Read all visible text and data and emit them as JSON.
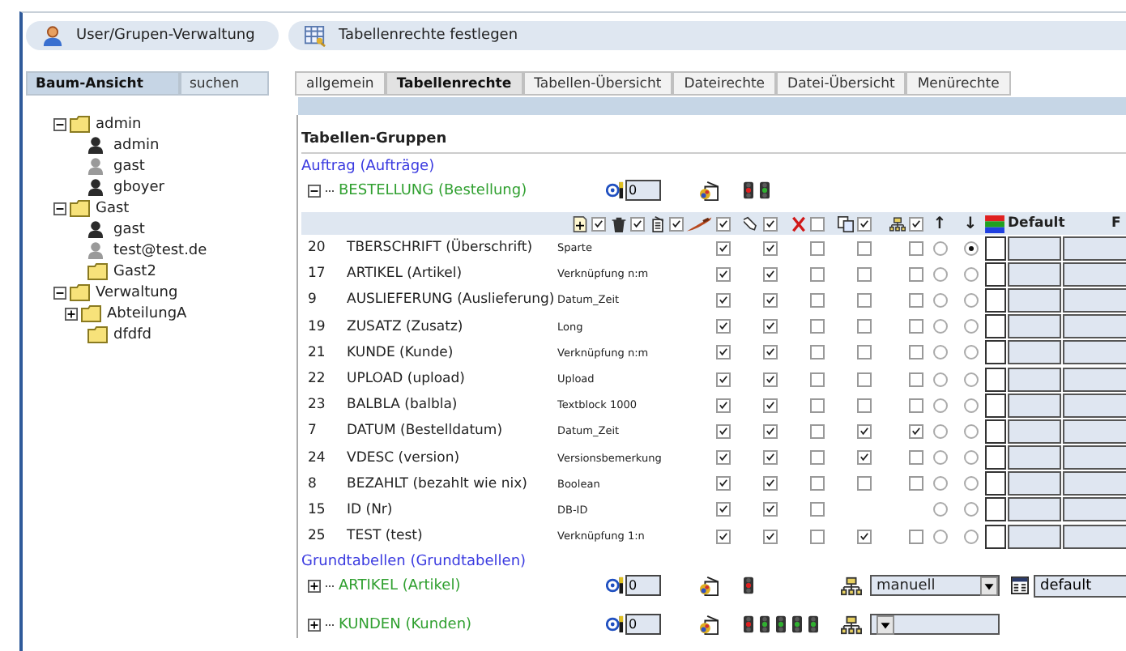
{
  "header_buttons": [
    {
      "kind": "user",
      "label": "User/Grupen-Verwaltung"
    },
    {
      "kind": "table",
      "label": "Tabellenrechte festlegen"
    }
  ],
  "sidebar": {
    "tabs": [
      {
        "label": "Baum-Ansicht",
        "selected": true
      },
      {
        "label": "suchen",
        "selected": false
      }
    ],
    "tree": [
      {
        "kind": "folder",
        "label": "admin",
        "expanded": true,
        "children": [
          {
            "kind": "user",
            "label": "admin",
            "active": true
          },
          {
            "kind": "user",
            "label": "gast",
            "active": false
          },
          {
            "kind": "user",
            "label": "gboyer",
            "active": true
          }
        ]
      },
      {
        "kind": "folder",
        "label": "Gast",
        "expanded": true,
        "children": [
          {
            "kind": "user",
            "label": "gast",
            "active": true
          },
          {
            "kind": "user",
            "label": "test@test.de",
            "active": false
          },
          {
            "kind": "folder",
            "label": "Gast2"
          }
        ]
      },
      {
        "kind": "folder",
        "label": "Verwaltung",
        "expanded": true,
        "children": [
          {
            "kind": "folder",
            "label": "AbteilungA",
            "expanded": false
          },
          {
            "kind": "folder",
            "label": "dfdfd"
          }
        ]
      }
    ]
  },
  "tabs": [
    {
      "label": "allgemein",
      "selected": false
    },
    {
      "label": "Tabellenrechte",
      "selected": true
    },
    {
      "label": "Tabellen-Übersicht",
      "selected": false
    },
    {
      "label": "Dateirechte",
      "selected": false
    },
    {
      "label": "Datei-Übersicht",
      "selected": false
    },
    {
      "label": "Menürechte",
      "selected": false
    }
  ],
  "section_title": "Tabellen-Gruppen",
  "groups": [
    {
      "label": "Auftrag (Aufträge)",
      "tables": [
        {
          "label": "BESTELLUNG (Bestellung)",
          "expanded": true,
          "count": "0",
          "lights": [
            {
              "color": "#e02020"
            },
            {
              "color": "#30b030"
            }
          ],
          "fields": {
            "header_icons": [
              {
                "kind": "new",
                "checked": true
              },
              {
                "kind": "trash",
                "checked": true
              },
              {
                "kind": "doc",
                "checked": true
              },
              {
                "kind": "brush",
                "checked": true
              },
              {
                "kind": "pencil",
                "checked": true
              },
              {
                "kind": "cross",
                "checked": false
              },
              {
                "kind": "copy",
                "checked": true
              },
              {
                "kind": "tree",
                "checked": true
              }
            ],
            "sort_labels": [
              "↑",
              "↓"
            ],
            "default_label": "Default",
            "cut_label": "F",
            "rows": [
              {
                "no": "20",
                "name": "TBERSCHRIFT (Überschrift)",
                "type": "Sparte",
                "checks": [
                  {
                    "checked": true
                  },
                  {
                    "checked": true
                  },
                  {
                    "checked": false
                  },
                  {
                    "checked": false
                  },
                  {
                    "checked": false
                  }
                ],
                "sort": [
                  {
                    "selected": false
                  },
                  {
                    "selected": true
                  }
                ]
              },
              {
                "no": "17",
                "name": "ARTIKEL (Artikel)",
                "type": "Verknüpfung n:m",
                "checks": [
                  {
                    "checked": true
                  },
                  {
                    "checked": true
                  },
                  {
                    "checked": false
                  },
                  {
                    "checked": false
                  },
                  {
                    "checked": false
                  }
                ],
                "sort": [
                  {
                    "selected": false
                  },
                  {
                    "selected": false
                  }
                ]
              },
              {
                "no": "9",
                "name": "AUSLIEFERUNG (Auslieferung)",
                "type": "Datum_Zeit",
                "checks": [
                  {
                    "checked": true
                  },
                  {
                    "checked": true
                  },
                  {
                    "checked": false
                  },
                  {
                    "checked": false
                  },
                  {
                    "checked": false
                  }
                ],
                "sort": [
                  {
                    "selected": false
                  },
                  {
                    "selected": false
                  }
                ]
              },
              {
                "no": "19",
                "name": "ZUSATZ (Zusatz)",
                "type": "Long",
                "checks": [
                  {
                    "checked": true
                  },
                  {
                    "checked": true
                  },
                  {
                    "checked": false
                  },
                  {
                    "checked": false
                  },
                  {
                    "checked": false
                  }
                ],
                "sort": [
                  {
                    "selected": false
                  },
                  {
                    "selected": false
                  }
                ]
              },
              {
                "no": "21",
                "name": "KUNDE (Kunde)",
                "type": "Verknüpfung n:m",
                "checks": [
                  {
                    "checked": true
                  },
                  {
                    "checked": true
                  },
                  {
                    "checked": false
                  },
                  {
                    "checked": false
                  },
                  {
                    "checked": false
                  }
                ],
                "sort": [
                  {
                    "selected": false
                  },
                  {
                    "selected": false
                  }
                ]
              },
              {
                "no": "22",
                "name": "UPLOAD (upload)",
                "type": "Upload",
                "checks": [
                  {
                    "checked": true
                  },
                  {
                    "checked": true
                  },
                  {
                    "checked": false
                  },
                  {
                    "checked": false
                  },
                  {
                    "checked": false
                  }
                ],
                "sort": [
                  {
                    "selected": false
                  },
                  {
                    "selected": false
                  }
                ]
              },
              {
                "no": "23",
                "name": "BALBLA (balbla)",
                "type": "Textblock 1000",
                "checks": [
                  {
                    "checked": true
                  },
                  {
                    "checked": true
                  },
                  {
                    "checked": false
                  },
                  {
                    "checked": false
                  },
                  {
                    "checked": false
                  }
                ],
                "sort": [
                  {
                    "selected": false
                  },
                  {
                    "selected": false
                  }
                ]
              },
              {
                "no": "7",
                "name": "DATUM (Bestelldatum)",
                "type": "Datum_Zeit",
                "checks": [
                  {
                    "checked": true
                  },
                  {
                    "checked": true
                  },
                  {
                    "checked": false
                  },
                  {
                    "checked": true
                  },
                  {
                    "checked": true
                  }
                ],
                "sort": [
                  {
                    "selected": false
                  },
                  {
                    "selected": false
                  }
                ]
              },
              {
                "no": "24",
                "name": "VDESC (version)",
                "type": "Versionsbemerkung",
                "checks": [
                  {
                    "checked": true
                  },
                  {
                    "checked": true
                  },
                  {
                    "checked": false
                  },
                  {
                    "checked": true
                  },
                  {
                    "checked": false
                  }
                ],
                "sort": [
                  {
                    "selected": false
                  },
                  {
                    "selected": false
                  }
                ]
              },
              {
                "no": "8",
                "name": "BEZAHLT (bezahlt wie nix)",
                "type": "Boolean",
                "checks": [
                  {
                    "checked": true
                  },
                  {
                    "checked": true
                  },
                  {
                    "checked": false
                  },
                  {
                    "checked": false
                  },
                  {
                    "checked": false
                  }
                ],
                "sort": [
                  {
                    "selected": false
                  },
                  {
                    "selected": false
                  }
                ]
              },
              {
                "no": "15",
                "name": "ID (Nr)",
                "type": "DB-ID",
                "checks": [
                  {
                    "checked": true
                  },
                  {
                    "checked": true
                  },
                  {
                    "checked": false
                  }
                ],
                "sort": [
                  {
                    "selected": false
                  },
                  {
                    "selected": false
                  }
                ]
              },
              {
                "no": "25",
                "name": "TEST (test)",
                "type": "Verknüpfung 1:n",
                "checks": [
                  {
                    "checked": true
                  },
                  {
                    "checked": true
                  },
                  {
                    "checked": false
                  },
                  {
                    "checked": true
                  },
                  {
                    "checked": false
                  }
                ],
                "sort": [
                  {
                    "selected": false
                  },
                  {
                    "selected": false
                  }
                ]
              }
            ]
          }
        }
      ]
    },
    {
      "label": "Grundtabellen (Grundtabellen)",
      "tables": [
        {
          "label": "ARTIKEL (Artikel)",
          "expanded": false,
          "count": "0",
          "lights": [
            {
              "color": "#e02020"
            }
          ],
          "mode_select": true,
          "mode_value": "manuell",
          "default_value": "default"
        },
        {
          "label": "KUNDEN (Kunden)",
          "expanded": false,
          "count": "0",
          "lights": [
            {
              "color": "#e02020"
            },
            {
              "color": "#30b030"
            },
            {
              "color": "#30b030"
            },
            {
              "color": "#30b030"
            },
            {
              "color": "#30b030"
            }
          ],
          "mode_select": true
        }
      ]
    }
  ]
}
